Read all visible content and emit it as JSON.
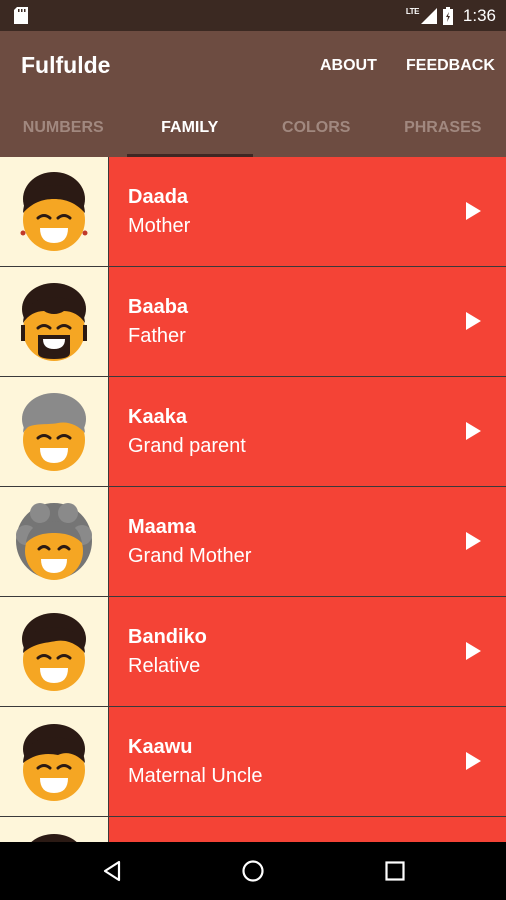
{
  "status_bar": {
    "time": "1:36",
    "network": "LTE"
  },
  "app_bar": {
    "title": "Fulfulde",
    "menu": [
      "ABOUT",
      "FEEDBACK"
    ]
  },
  "tabs": [
    {
      "label": "NUMBERS",
      "active": false
    },
    {
      "label": "FAMILY",
      "active": true
    },
    {
      "label": "COLORS",
      "active": false
    },
    {
      "label": "PHRASES",
      "active": false
    }
  ],
  "colors": {
    "list_background": "#F44336",
    "thumbnail_background": "#FEF6DA",
    "app_bar": "#6D4C41",
    "status_bar": "#3B2922",
    "face": "#F5A623"
  },
  "family": [
    {
      "word": "Daada",
      "translation": "Mother",
      "icon": "mother-face-icon"
    },
    {
      "word": "Baaba",
      "translation": "Father",
      "icon": "father-face-icon"
    },
    {
      "word": "Kaaka",
      "translation": "Grand parent",
      "icon": "grandparent-face-icon"
    },
    {
      "word": "Maama",
      "translation": "Grand Mother",
      "icon": "grandmother-face-icon"
    },
    {
      "word": "Bandiko",
      "translation": "Relative",
      "icon": "relative-face-icon"
    },
    {
      "word": "Kaawu",
      "translation": "Maternal Uncle",
      "icon": "uncle-face-icon"
    }
  ],
  "nav": [
    "back-icon",
    "home-icon",
    "recents-icon"
  ]
}
